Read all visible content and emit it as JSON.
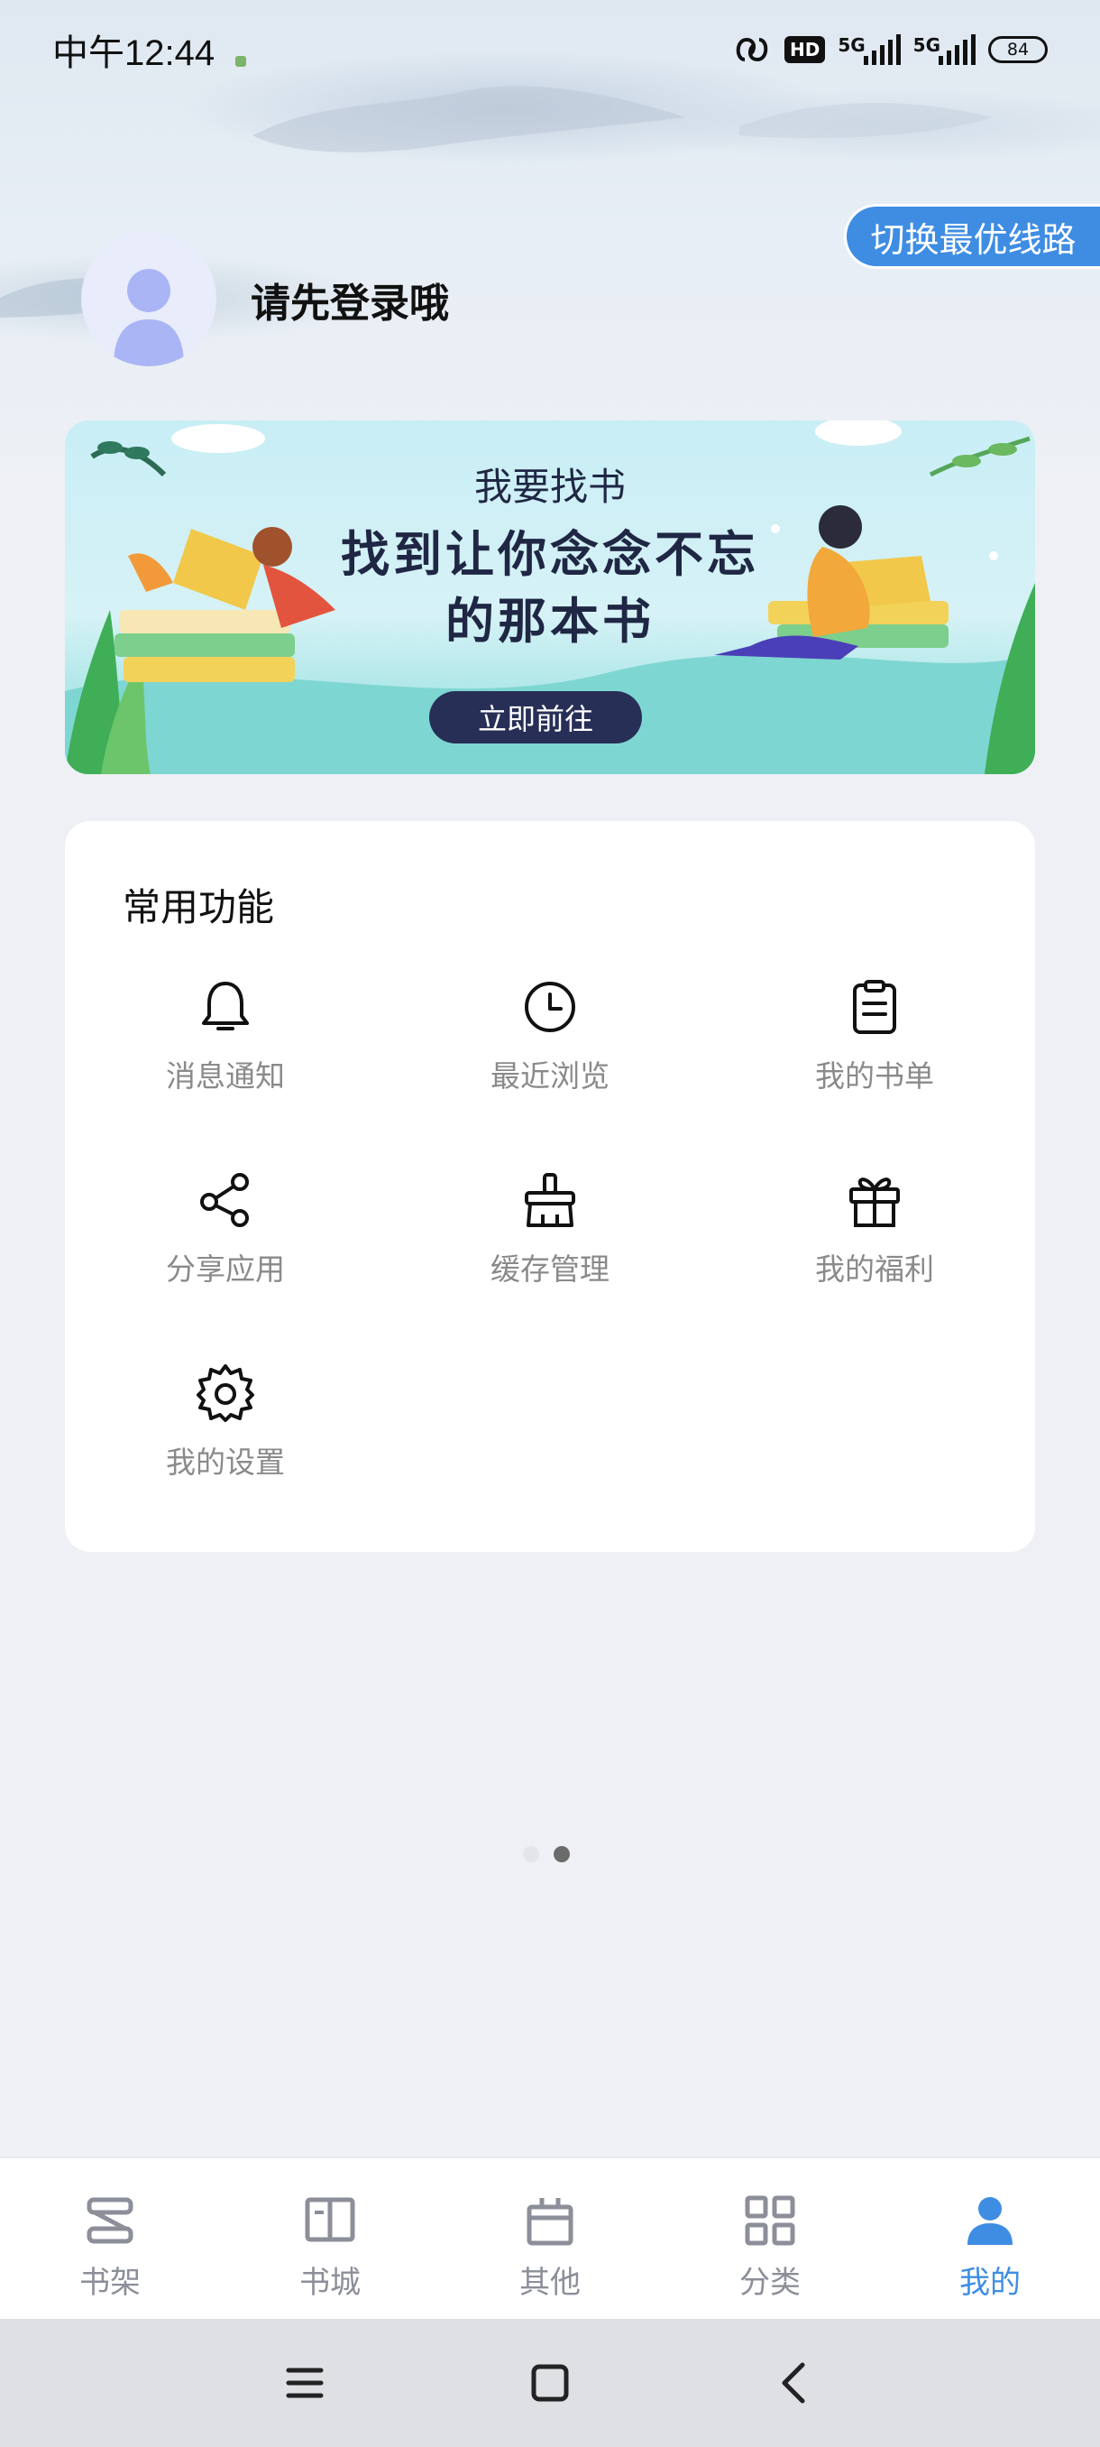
{
  "status_bar": {
    "time": "中午12:44",
    "network_1": "5G",
    "network_2": "5G",
    "hd_label": "HD",
    "battery": "84"
  },
  "header": {
    "switch_line_label": "切换最优线路",
    "login_prompt": "请先登录哦"
  },
  "banner": {
    "title": "我要找书",
    "slogan_line1": "找到让你念念不忘",
    "slogan_line2": "的那本书",
    "cta_label": "立即前往"
  },
  "functions": {
    "title": "常用功能",
    "items": [
      {
        "label": "消息通知",
        "icon": "bell-icon"
      },
      {
        "label": "最近浏览",
        "icon": "clock-icon"
      },
      {
        "label": "我的书单",
        "icon": "clipboard-icon"
      },
      {
        "label": "分享应用",
        "icon": "share-icon"
      },
      {
        "label": "缓存管理",
        "icon": "broom-icon"
      },
      {
        "label": "我的福利",
        "icon": "gift-icon"
      },
      {
        "label": "我的设置",
        "icon": "gear-icon"
      }
    ]
  },
  "pager": {
    "count": 2,
    "active_index": 1
  },
  "tabbar": {
    "active_color": "#3e8de3",
    "inactive_color": "#8c8f99",
    "items": [
      {
        "label": "书架",
        "icon": "bookshelf-icon"
      },
      {
        "label": "书城",
        "icon": "open-book-icon"
      },
      {
        "label": "其他",
        "icon": "box-icon"
      },
      {
        "label": "分类",
        "icon": "grid-icon"
      },
      {
        "label": "我的",
        "icon": "person-icon",
        "active": true
      }
    ]
  }
}
